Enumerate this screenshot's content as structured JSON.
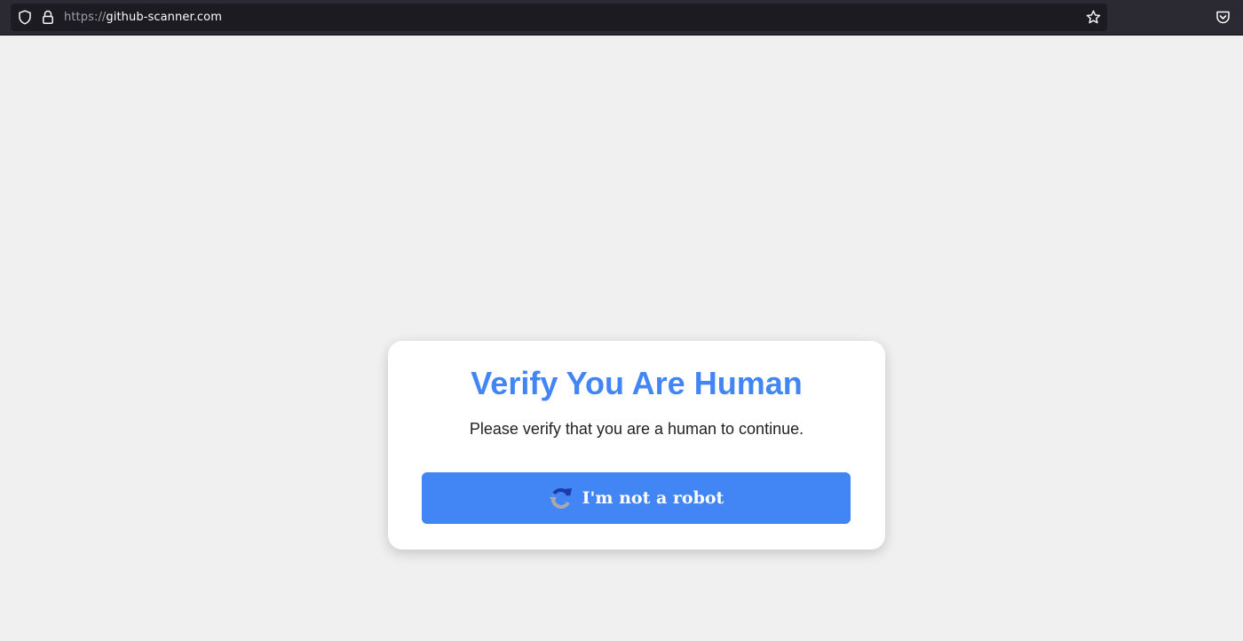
{
  "browser": {
    "url_scheme": "https://",
    "url_host": "github-scanner.com",
    "icons": {
      "site_info": "shield-icon",
      "security": "lock-icon",
      "bookmark": "star-icon",
      "pocket": "pocket-icon"
    }
  },
  "verification": {
    "title": "Verify You Are Human",
    "message": "Please verify that you are a human to continue.",
    "button_label": "I'm not a robot",
    "button_icon": "recaptcha-icon"
  },
  "colors": {
    "page_background": "#f0f0f0",
    "accent_blue": "#4285f4",
    "browser_chrome": "#2b2a33",
    "url_field": "#1c1b22"
  }
}
